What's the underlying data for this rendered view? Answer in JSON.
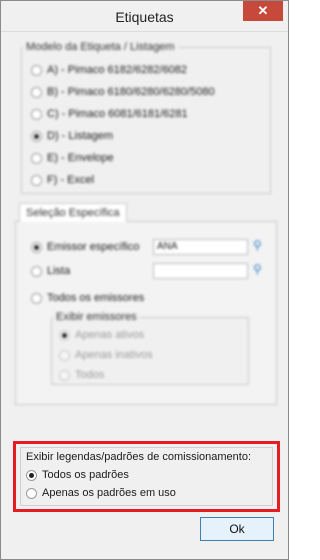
{
  "window": {
    "title": "Etiquetas",
    "close_glyph": "✕"
  },
  "model_group": {
    "title": "Modelo da Etiqueta / Listagem",
    "options": [
      {
        "label": "A) - Pimaco 6182/6282/6082",
        "selected": false
      },
      {
        "label": "B) - Pimaco 6180/6280/6280/5080",
        "selected": false
      },
      {
        "label": "C) - Pimaco 6081/6181/6281",
        "selected": false
      },
      {
        "label": "D) - Listagem",
        "selected": true
      },
      {
        "label": "E) - Envelope",
        "selected": false
      },
      {
        "label": "F) - Excel",
        "selected": false
      }
    ]
  },
  "selection_group": {
    "tab_label": "Seleção Específica",
    "emitter_specific": {
      "label": "Emissor específico",
      "value": "ANA",
      "selected": true
    },
    "list": {
      "label": "Lista",
      "value": "",
      "selected": false
    },
    "all_emitters": {
      "label": "Todos os emissores",
      "selected": false
    },
    "show_emitters": {
      "title": "Exibir emissores",
      "options": [
        {
          "label": "Apenas ativos",
          "selected": true
        },
        {
          "label": "Apenas inativos",
          "selected": false
        },
        {
          "label": "Todos",
          "selected": false
        }
      ]
    }
  },
  "legend_group": {
    "title": "Exibir legendas/padrões de comissionamento:",
    "options": [
      {
        "label": "Todos os padrões",
        "selected": true
      },
      {
        "label": "Apenas os padrões em uso",
        "selected": false
      }
    ]
  },
  "ok_button": {
    "label": "Ok"
  },
  "icons": {
    "close": "close-icon",
    "lookup": "search-add-icon"
  },
  "colors": {
    "highlight": "#e51c24",
    "close_bg": "#c7493b",
    "ok_border": "#3c7fb1"
  }
}
